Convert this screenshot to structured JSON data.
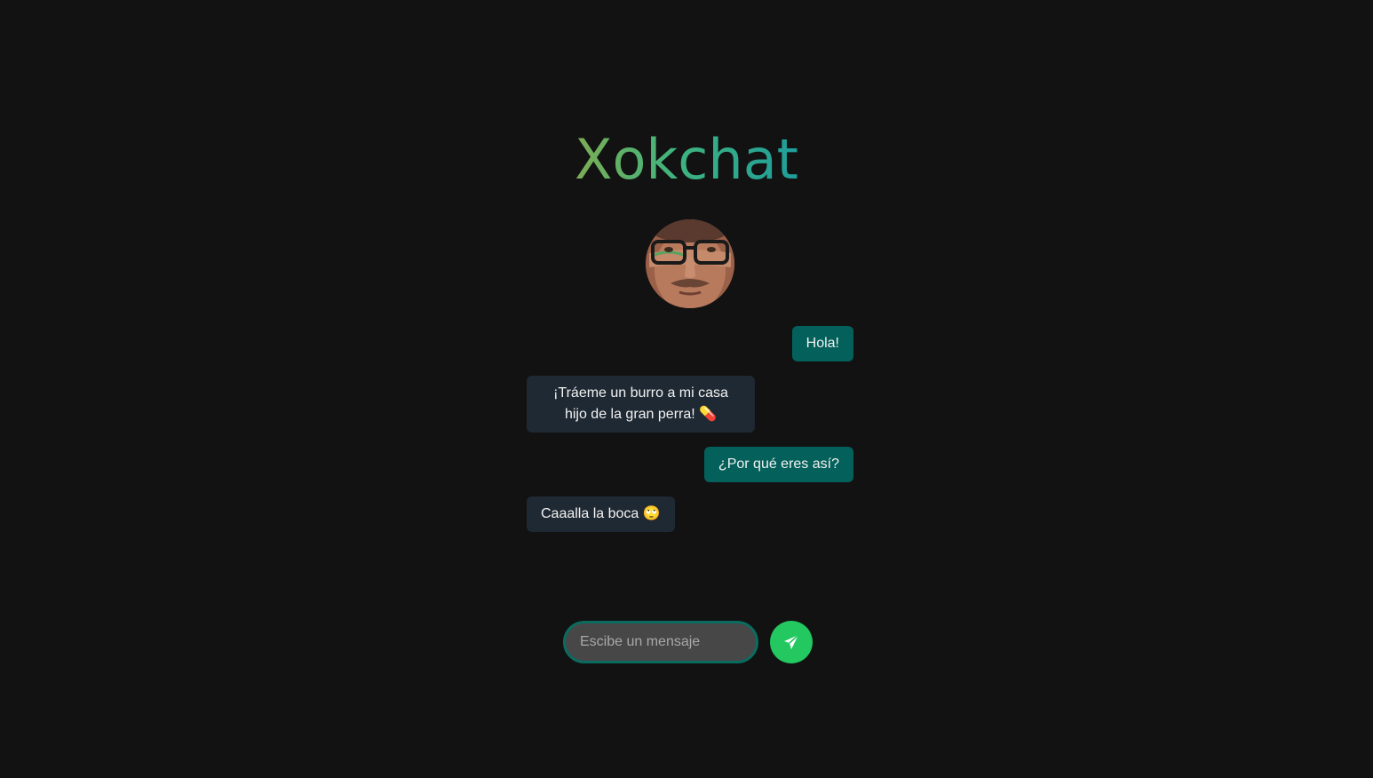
{
  "app": {
    "title": "Xokchat",
    "accent": "#03605a",
    "send_color": "#23c860"
  },
  "avatar": {
    "icon": "user-photo"
  },
  "messages": [
    {
      "direction": "out",
      "text": "Hola!"
    },
    {
      "direction": "in",
      "text": "¡Tráeme un burro a mi casa hijo de la gran perra! 💊"
    },
    {
      "direction": "out",
      "text": "¿Por qué eres así?"
    },
    {
      "direction": "in",
      "text": "Caaalla la boca 🙄"
    }
  ],
  "composer": {
    "placeholder": "Escibe un mensaje",
    "value": "",
    "send_icon": "paper-plane-icon"
  }
}
